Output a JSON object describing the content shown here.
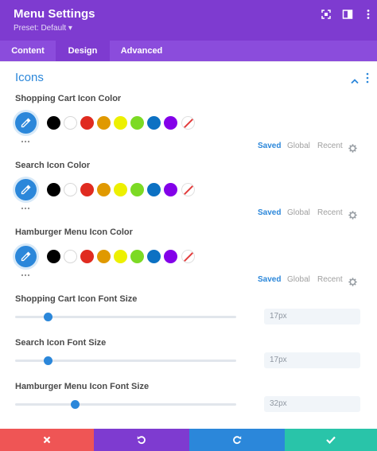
{
  "header": {
    "title": "Menu Settings",
    "preset": "Preset: Default ▾",
    "icons": [
      "expand-icon",
      "sidebar-toggle-icon",
      "more-options-icon"
    ]
  },
  "tabs": [
    {
      "label": "Content",
      "active": false
    },
    {
      "label": "Design",
      "active": true
    },
    {
      "label": "Advanced",
      "active": false
    }
  ],
  "section": {
    "title": "Icons"
  },
  "palette": [
    "#000000",
    "#ffffff",
    "#e02b20",
    "#e09900",
    "#edf000",
    "#7cda24",
    "#0c71c3",
    "#8300e9"
  ],
  "color_fields": [
    {
      "label": "Shopping Cart Icon Color",
      "tabs": [
        "Saved",
        "Global",
        "Recent"
      ]
    },
    {
      "label": "Search Icon Color",
      "tabs": [
        "Saved",
        "Global",
        "Recent"
      ]
    },
    {
      "label": "Hamburger Menu Icon Color",
      "tabs": [
        "Saved",
        "Global",
        "Recent"
      ]
    }
  ],
  "size_fields": [
    {
      "label": "Shopping Cart Icon Font Size",
      "value": "17px",
      "slider_fraction": 0.15
    },
    {
      "label": "Search Icon Font Size",
      "value": "17px",
      "slider_fraction": 0.15
    },
    {
      "label": "Hamburger Menu Icon Font Size",
      "value": "32px",
      "slider_fraction": 0.27
    }
  ],
  "footer": {
    "buttons": [
      "cancel",
      "undo",
      "redo",
      "save"
    ],
    "colors": [
      "#ef5555",
      "#7e3bd0",
      "#2b87da",
      "#29c4a9"
    ]
  }
}
